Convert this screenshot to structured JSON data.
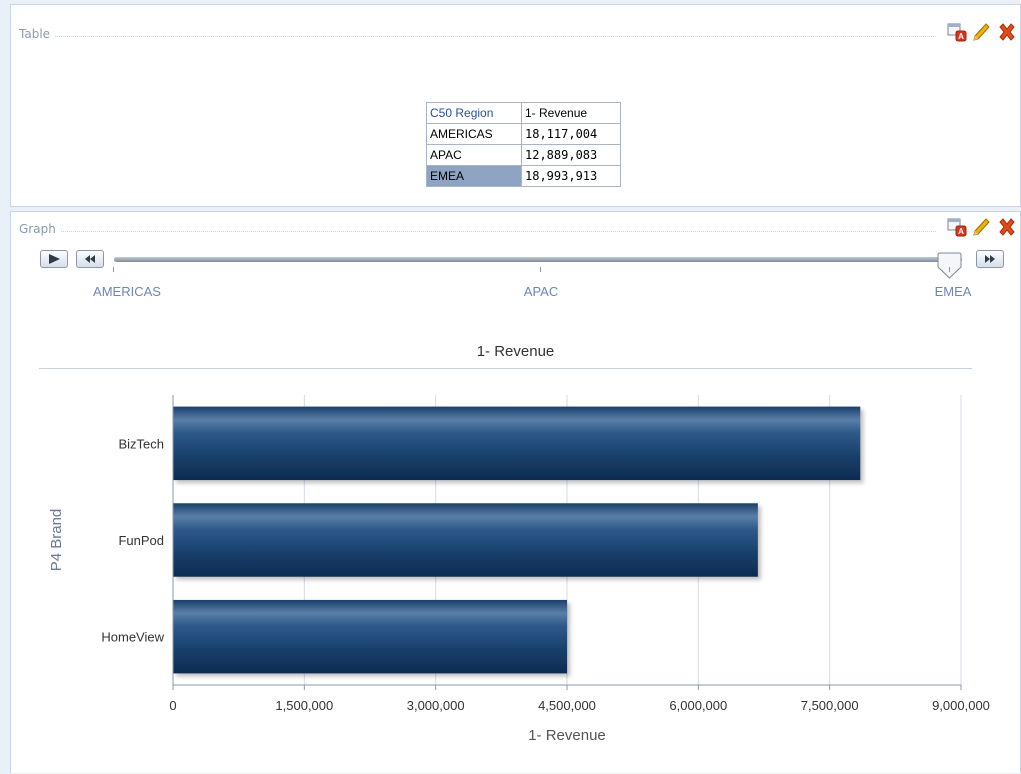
{
  "table_view": {
    "title": "Table",
    "columns": [
      "C50 Region",
      "1- Revenue"
    ],
    "rows": [
      {
        "region": "AMERICAS",
        "revenue": "18,117,004"
      },
      {
        "region": "APAC",
        "revenue": "12,889,083"
      },
      {
        "region": "EMEA",
        "revenue": "18,993,913"
      }
    ],
    "selected_region": "EMEA"
  },
  "graph_view": {
    "title": "Graph",
    "slider": {
      "labels": [
        "AMERICAS",
        "APAC",
        "EMEA"
      ],
      "selected": "EMEA"
    }
  },
  "chart_data": {
    "type": "bar",
    "orientation": "horizontal",
    "title": "1- Revenue",
    "xlabel": "1- Revenue",
    "ylabel": "P4  Brand",
    "categories": [
      "BizTech",
      "FunPod",
      "HomeView"
    ],
    "values": [
      7850000,
      6680000,
      4500000
    ],
    "xlim": [
      0,
      9000000
    ],
    "xticks": [
      "0",
      "1,500,000",
      "3,000,000",
      "4,500,000",
      "6,000,000",
      "7,500,000",
      "9,000,000"
    ],
    "grid": true,
    "bar_color": "#1e4b7d"
  }
}
